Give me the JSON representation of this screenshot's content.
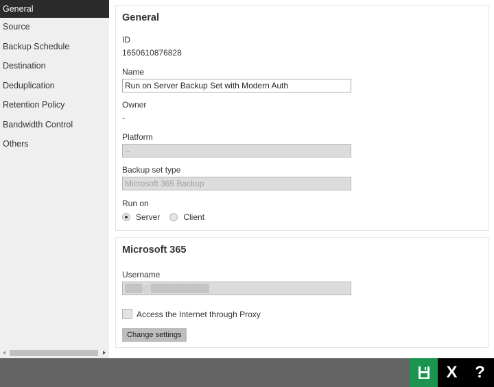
{
  "sidebar": {
    "items": [
      {
        "label": "General",
        "active": true
      },
      {
        "label": "Source"
      },
      {
        "label": "Backup Schedule"
      },
      {
        "label": "Destination"
      },
      {
        "label": "Deduplication"
      },
      {
        "label": "Retention Policy"
      },
      {
        "label": "Bandwidth Control"
      },
      {
        "label": "Others"
      }
    ]
  },
  "general": {
    "title": "General",
    "id_label": "ID",
    "id_value": "1650610876828",
    "name_label": "Name",
    "name_value": "Run on Server Backup Set with Modern Auth",
    "owner_label": "Owner",
    "owner_value": "-",
    "platform_label": "Platform",
    "platform_value": "--",
    "backup_set_type_label": "Backup set type",
    "backup_set_type_value": "Microsoft 365 Backup",
    "run_on_label": "Run on",
    "run_on_options": [
      {
        "label": "Server",
        "checked": true
      },
      {
        "label": "Client",
        "checked": false
      }
    ]
  },
  "m365": {
    "title": "Microsoft 365",
    "username_label": "Username",
    "username_value": "███@██████████",
    "proxy_label": "Access the Internet through Proxy",
    "proxy_checked": false,
    "change_settings_label": "Change settings"
  },
  "footer": {
    "save_icon": "floppy-disk-icon",
    "close_label": "X",
    "help_label": "?",
    "save_color": "#1a9450"
  }
}
